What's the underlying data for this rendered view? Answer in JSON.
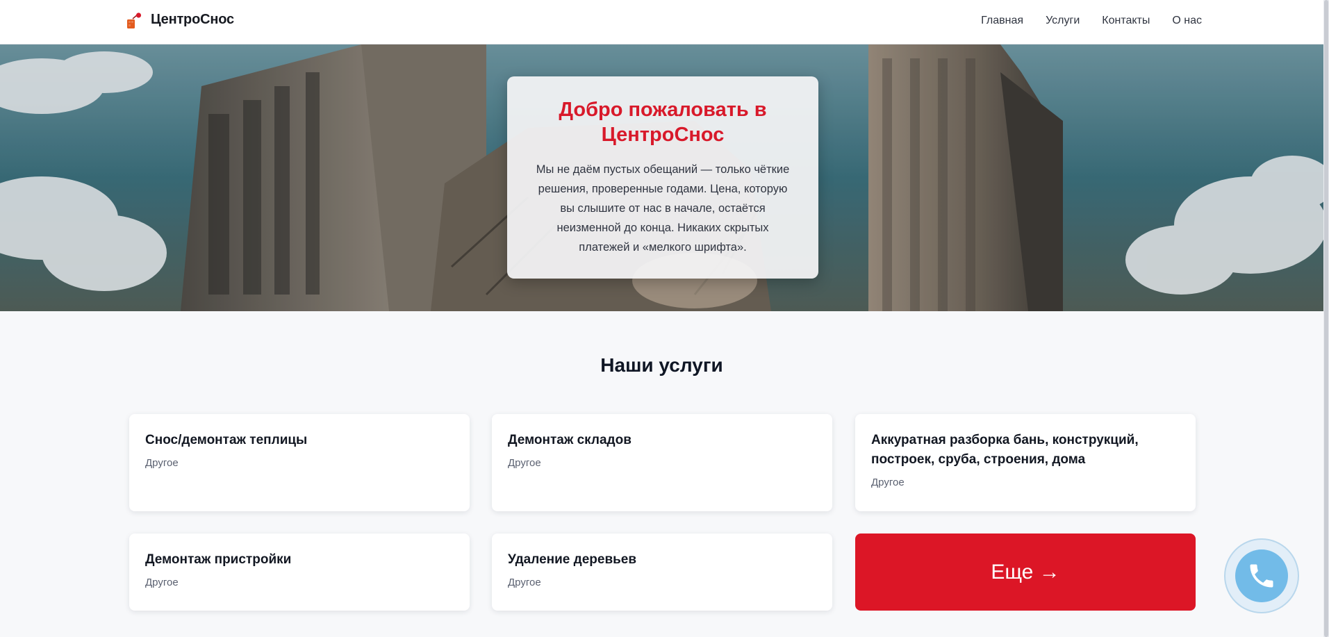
{
  "header": {
    "brand": "ЦентроСнос",
    "nav": [
      "Главная",
      "Услуги",
      "Контакты",
      "О нас"
    ]
  },
  "hero": {
    "title": "Добро пожаловать в ЦентроСнос",
    "text": "Мы не даём пустых обещаний — только чёткие решения, проверенные годами. Цена, которую вы слышите от нас в начале, остаётся неизменной до конца. Никаких скрытых платежей и «мелкого шрифта»."
  },
  "services": {
    "title": "Наши услуги",
    "items": [
      {
        "title": "Снос/демонтаж теплицы",
        "category": "Другое"
      },
      {
        "title": "Демонтаж складов",
        "category": "Другое"
      },
      {
        "title": "Аккуратная разборка бань, конструкций, построек, сруба, строения, дома",
        "category": "Другое"
      },
      {
        "title": "Демонтаж пристройки",
        "category": "Другое"
      },
      {
        "title": "Удаление деревьев",
        "category": "Другое"
      }
    ],
    "more_label": "Еще →"
  },
  "icons": {
    "logo": "demolition-logo-icon",
    "call": "phone-icon"
  },
  "colors": {
    "accent": "#dc1626",
    "call_button": "#72bbe8"
  }
}
